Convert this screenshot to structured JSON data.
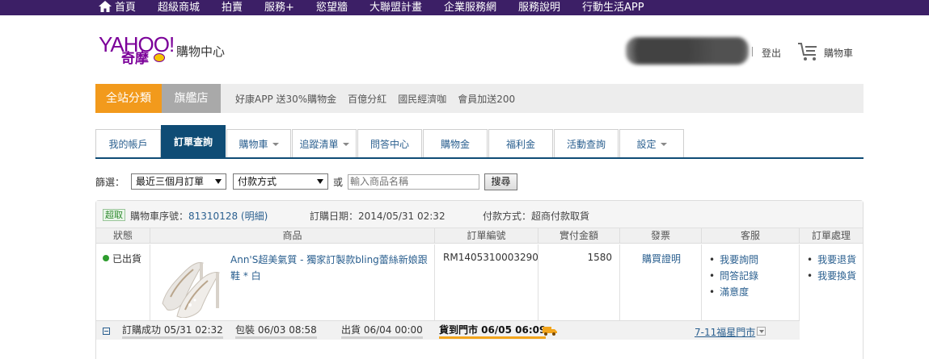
{
  "topnav": {
    "items": [
      "首頁",
      "超級商城",
      "拍賣",
      "服務+",
      "慾望牆",
      "大聯盟計畫",
      "企業服務網",
      "服務說明",
      "行動生活APP"
    ]
  },
  "header": {
    "logo_text": "YAHOO!",
    "logo_sub": "奇摩",
    "site_title": "購物中心",
    "logout": "登出",
    "cart": "購物車"
  },
  "catbar": {
    "all": "全站分類",
    "flagship": "旗艦店",
    "promos": [
      "好康APP 送30%購物金",
      "百億分紅",
      "國民經濟咖",
      "會員加送200"
    ]
  },
  "tabs": [
    {
      "label": "我的帳戶",
      "dropdown": false
    },
    {
      "label": "訂單查詢",
      "dropdown": false,
      "active": true
    },
    {
      "label": "購物車",
      "dropdown": true
    },
    {
      "label": "追蹤清單",
      "dropdown": true
    },
    {
      "label": "問答中心",
      "dropdown": false
    },
    {
      "label": "購物金",
      "dropdown": false
    },
    {
      "label": "福利金",
      "dropdown": false
    },
    {
      "label": "活動查詢",
      "dropdown": false
    },
    {
      "label": "設定",
      "dropdown": true
    }
  ],
  "filter": {
    "label": "篩選：",
    "period": "最近三個月訂單",
    "payment": "付款方式",
    "or": "或",
    "search_placeholder": "輸入商品名稱",
    "search_button": "搜尋"
  },
  "order": {
    "badge": "超取",
    "cart_no_label": "購物車序號：",
    "cart_no": "81310128",
    "detail_link": "(明細)",
    "date_label": "訂購日期：",
    "date": "2014/05/31 02:32",
    "payment_label": "付款方式：",
    "payment": "超商付款取貨",
    "columns": [
      "狀態",
      "商品",
      "訂單編號",
      "實付金額",
      "發票",
      "客服",
      "訂單處理"
    ],
    "status": "已出貨",
    "product": "Ann'S超美氣質 - 獨家訂製款bling蕾絲新娘跟鞋 * 白",
    "order_no": "RM1405310003290",
    "amount": "1580",
    "invoice": "購買證明",
    "service": [
      "我要詢問",
      "問答記錄",
      "滿意度"
    ],
    "actions": [
      "我要退貨",
      "我要換貨"
    ],
    "steps": [
      {
        "label": "訂購成功 05/31 02:32"
      },
      {
        "label": "包裝 06/03 08:58"
      },
      {
        "label": "出貨 06/04 00:00"
      },
      {
        "label": "貨到門市 06/05 06:09",
        "current": true
      }
    ],
    "store": "7-11福星門市"
  },
  "colors": {
    "topbar": "#3c1f66",
    "brand": "#7b0099",
    "orange": "#f29a1c",
    "tab_active": "#0f4c75",
    "link": "#2a5f8f"
  }
}
